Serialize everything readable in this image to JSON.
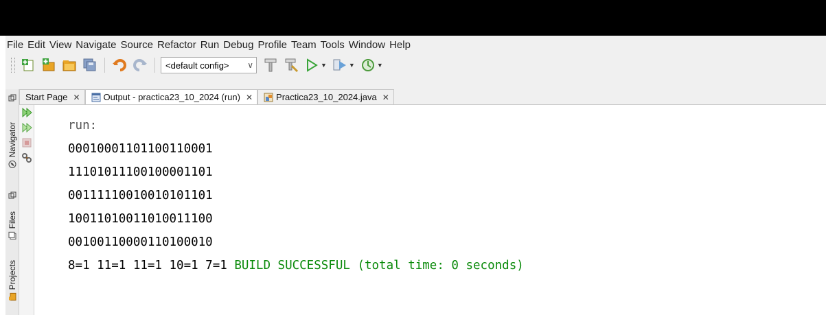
{
  "menu": [
    "File",
    "Edit",
    "View",
    "Navigate",
    "Source",
    "Refactor",
    "Run",
    "Debug",
    "Profile",
    "Team",
    "Tools",
    "Window",
    "Help"
  ],
  "toolbar": {
    "config_value": "<default config>",
    "icons": [
      "new-file-icon",
      "new-project-icon",
      "open-project-icon",
      "save-all-icon",
      "undo-icon",
      "redo-icon",
      "build-hammer-icon",
      "clean-build-icon",
      "run-icon",
      "debug-icon",
      "profile-icon"
    ]
  },
  "side_tabs": {
    "navigator": "Navigator",
    "files": "Files",
    "projects": "Projects"
  },
  "tabs": [
    {
      "label": "Start Page",
      "active": false
    },
    {
      "label": "Output - practica23_10_2024 (run)",
      "active": true
    },
    {
      "label": "Practica23_10_2024.java",
      "active": false
    }
  ],
  "output": {
    "run_label": "run:",
    "lines": [
      "00010001101100110001",
      "11101011100100001101",
      "00111110010010101101",
      "10011010011010011100",
      "00100110000110100010"
    ],
    "counts": "8=1 11=1 11=1 10=1 7=1 ",
    "build_status": "BUILD SUCCESSFUL (total time: 0 seconds)"
  },
  "colors": {
    "build_success": "#0a8a0a",
    "title_bar": "#000000"
  }
}
